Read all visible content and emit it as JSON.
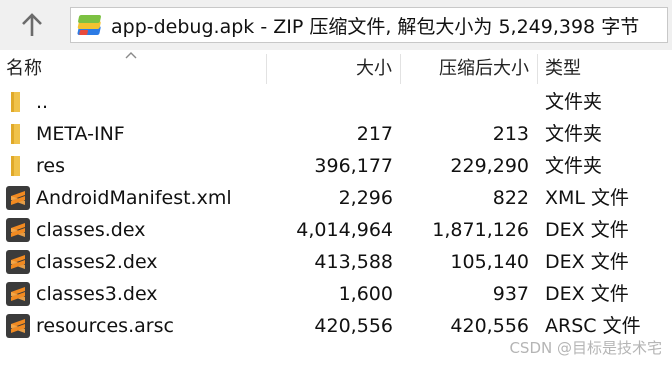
{
  "toolbar": {
    "address": "app-debug.apk - ZIP 压缩文件, 解包大小为 5,249,398 字节"
  },
  "columns": {
    "name": "名称",
    "size": "大小",
    "compressed": "压缩后大小",
    "type": "类型"
  },
  "rows": [
    {
      "name": "..",
      "size": "",
      "compressed": "",
      "type": "文件夹",
      "icon": "folder-icon"
    },
    {
      "name": "META-INF",
      "size": "217",
      "compressed": "213",
      "type": "文件夹",
      "icon": "folder-icon"
    },
    {
      "name": "res",
      "size": "396,177",
      "compressed": "229,290",
      "type": "文件夹",
      "icon": "folder-icon"
    },
    {
      "name": "AndroidManifest.xml",
      "size": "2,296",
      "compressed": "822",
      "type": "XML 文件",
      "icon": "sublime-file-icon"
    },
    {
      "name": "classes.dex",
      "size": "4,014,964",
      "compressed": "1,871,126",
      "type": "DEX 文件",
      "icon": "sublime-file-icon"
    },
    {
      "name": "classes2.dex",
      "size": "413,588",
      "compressed": "105,140",
      "type": "DEX 文件",
      "icon": "sublime-file-icon"
    },
    {
      "name": "classes3.dex",
      "size": "1,600",
      "compressed": "937",
      "type": "DEX 文件",
      "icon": "sublime-file-icon"
    },
    {
      "name": "resources.arsc",
      "size": "420,556",
      "compressed": "420,556",
      "type": "ARSC 文件",
      "icon": "sublime-file-icon"
    }
  ],
  "watermark": "CSDN @目标是技术宅",
  "colors": {
    "folder": "#f0c24b",
    "file_icon_bg": "#3b3b3b",
    "file_icon_accent": "#f18a21"
  }
}
